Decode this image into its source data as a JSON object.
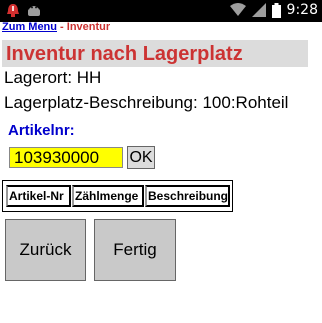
{
  "status_bar": {
    "time": "9:28",
    "icons": [
      "notification-icon",
      "android-icon",
      "wifi-icon",
      "signal-icon",
      "battery-icon"
    ]
  },
  "breadcrumb": {
    "link": "Zum Menu",
    "separator": " - ",
    "current": "Inventur"
  },
  "title": "Inventur nach Lagerplatz",
  "lagerort": "Lagerort: HH",
  "lagerplatz": "Lagerplatz-Beschreibung: 100:Rohteil",
  "artikel_label": "Artikelnr:",
  "artikel_input": {
    "value": "103930000"
  },
  "ok_label": "OK",
  "table": {
    "headers": [
      "Artikel-Nr",
      "Zählmenge",
      "Beschreibung"
    ]
  },
  "buttons": {
    "back": "Zurück",
    "done": "Fertig"
  },
  "colors": {
    "title": "#cc3333",
    "link": "#0000cc",
    "input_bg": "#ffff00",
    "title_bg": "#dcdcdc",
    "button_bg": "#c9c9c9"
  }
}
